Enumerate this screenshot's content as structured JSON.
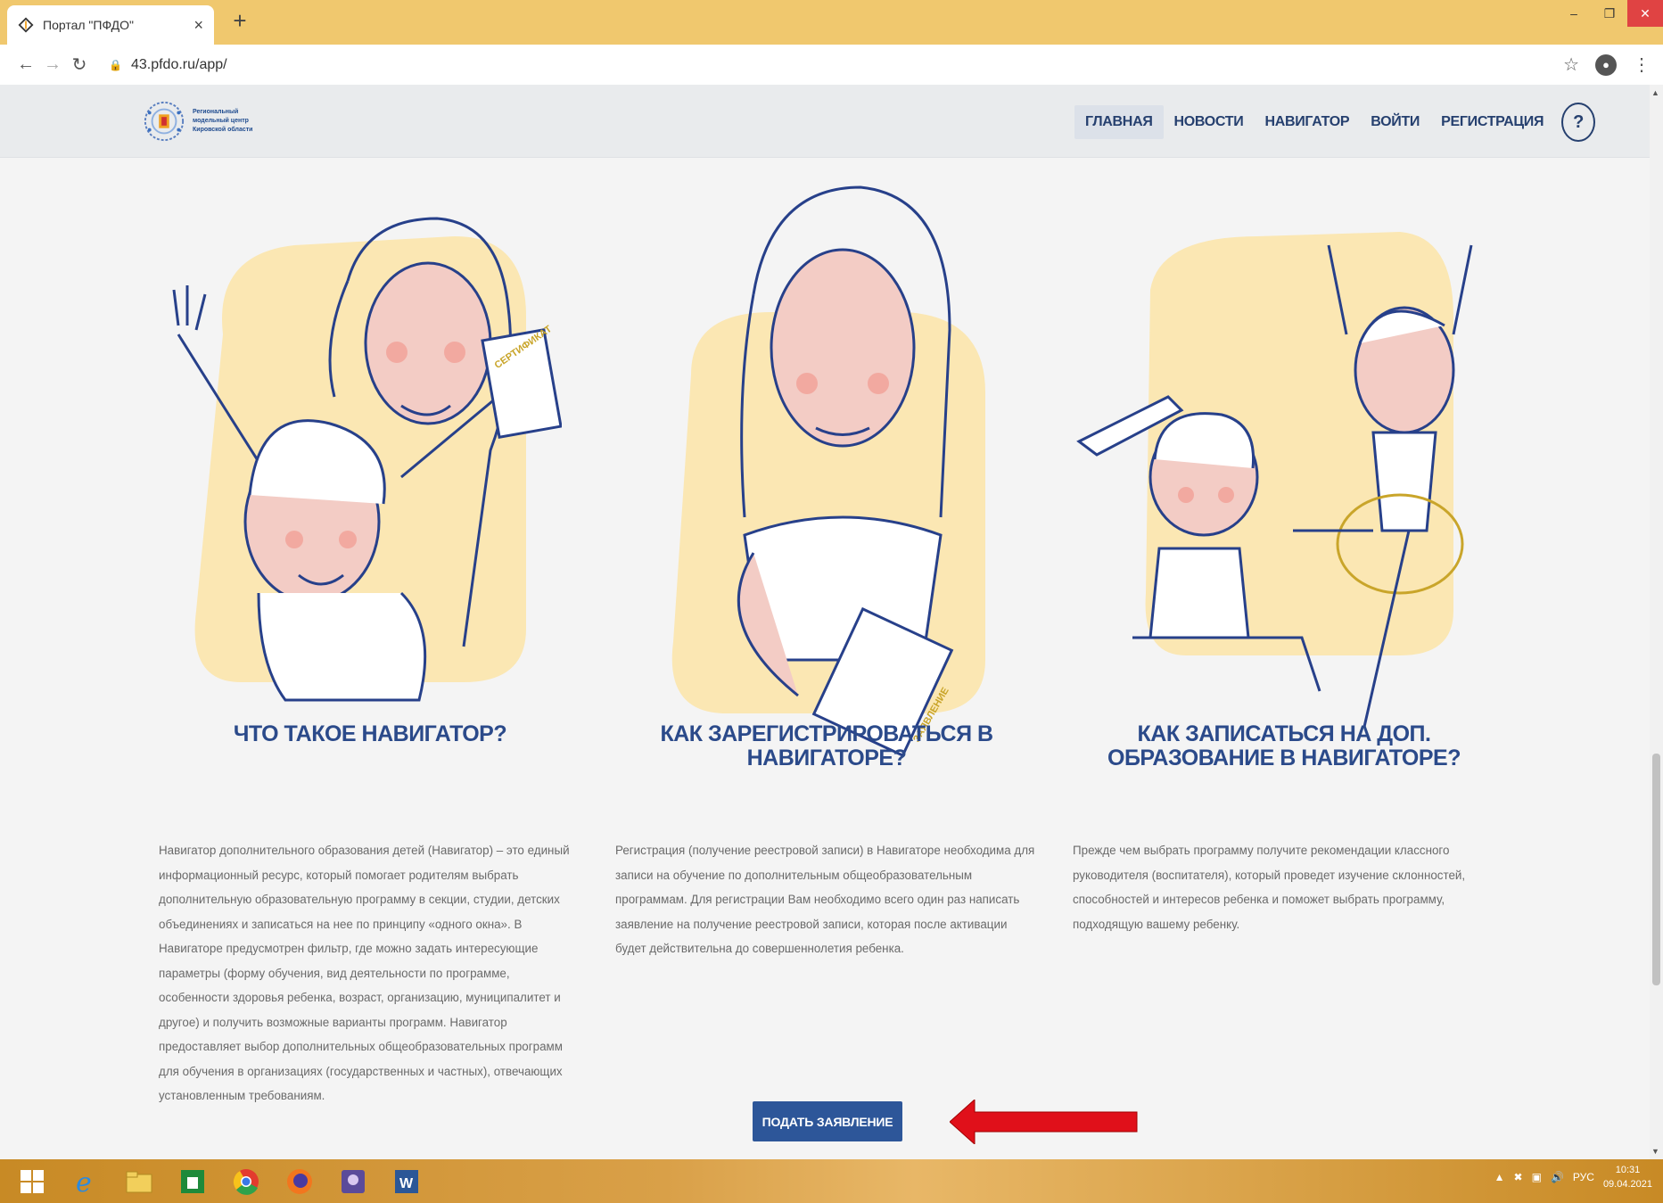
{
  "browser": {
    "tab_title": "Портал \"ПФДО\"",
    "url": "43.pfdo.ru/app/",
    "close_glyph": "×",
    "newtab_glyph": "+"
  },
  "header": {
    "logo_text": "Региональный модельный центр Кировской области",
    "menu": [
      "ГЛАВНАЯ",
      "НОВОСТИ",
      "НАВИГАТОР",
      "ВОЙТИ",
      "РЕГИСТРАЦИЯ"
    ],
    "active_item": "ГЛАВНАЯ",
    "help_label": "?"
  },
  "columns": [
    {
      "heading": "ЧТО ТАКОЕ НАВИГАТОР?",
      "text": "Навигатор дополнительного образования детей (Навигатор) – это единый информационный ресурс, который помогает родителям выбрать дополнительную образовательную программу в секции, студии, детских объединениях и записаться на нее по принципу «одного окна». В Навигаторе предусмотрен фильтр, где можно задать интересующие параметры (форму обучения, вид деятельности по программе, особенности здоровья ребенка, возраст, организацию, муниципалитет и другое) и получить возможные варианты программ. Навигатор предоставляет выбор дополнительных общеобразовательных программ для обучения в организациях (государственных и частных), отвечающих установленным требованиям.",
      "illustration": "Mother and daughter with certificate",
      "certificate_label": "СЕРТИФИКАТ"
    },
    {
      "heading": "КАК ЗАРЕГИСТРИРОВАТЬСЯ В НАВИГАТОРЕ?",
      "text": "Регистрация (получение реестровой записи) в Навигаторе необходима для записи на обучение по дополнительным общеобразовательным программам. Для регистрации Вам необходимо всего один раз написать заявление на получение реестровой записи, которая после активации будет действительна до совершеннолетия ребенка.",
      "illustration": "Woman holding application",
      "application_label": "ЗАЯВЛЕНИЕ"
    },
    {
      "heading": "КАК ЗАПИСАТЬСЯ НА ДОП. ОБРАЗОВАНИЕ В НАВИГАТОРЕ?",
      "text": "Прежде чем выбрать программу получите рекомендации классного руководителя (воспитателя), который проведет изучение склонностей, способностей и интересов ребенка и поможет выбрать программу, подходящую вашему ребенку.",
      "illustration": "Boy with airplane and girl ballerina"
    }
  ],
  "submit_label": "ПОДАТЬ ЗАЯВЛЕНИЕ",
  "taskbar": {
    "lang": "РУС",
    "time": "10:31",
    "date": "09.04.2021"
  },
  "colors": {
    "accent": "#2b4a8a",
    "button": "#2d5699",
    "arrow": "#e0101a",
    "blob": "#fbe7b3"
  }
}
